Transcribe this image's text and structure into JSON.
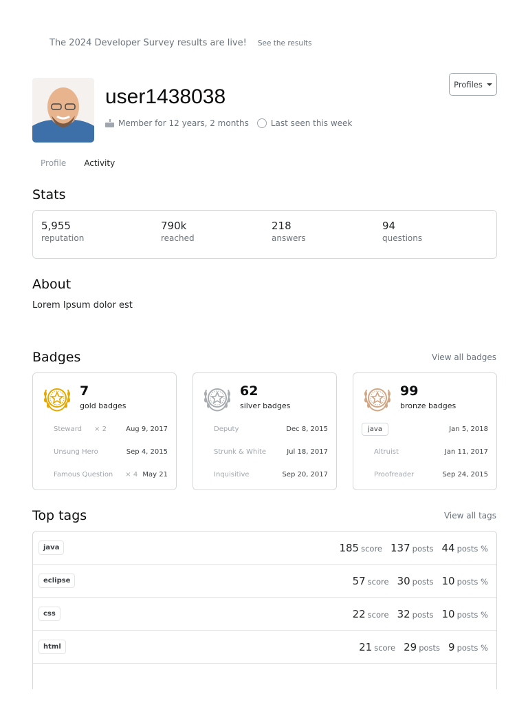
{
  "banner": {
    "text": "The 2024 Developer Survey results are live!",
    "link": "See the results"
  },
  "user": {
    "name": "user1438038",
    "member": "Member for 12 years, 2 months",
    "last_seen": "Last seen this week"
  },
  "profiles_button": "Profiles",
  "tabs": [
    {
      "label": "Profile"
    },
    {
      "label": "Activity"
    }
  ],
  "stats": {
    "title": "Stats",
    "items": [
      {
        "value": "5,955",
        "label": "reputation"
      },
      {
        "value": "790k",
        "label": "reached"
      },
      {
        "value": "218",
        "label": "answers"
      },
      {
        "value": "94",
        "label": "questions"
      }
    ]
  },
  "about": {
    "title": "About",
    "text": "Lorem Ipsum dolor est"
  },
  "badges": {
    "title": "Badges",
    "view_all": "View all badges",
    "cards": [
      {
        "count": "7",
        "kind": "gold badges",
        "color": "#e5a800",
        "rows": [
          {
            "name": "Steward",
            "mult": "× 2",
            "date": "Aug 9, 2017"
          },
          {
            "name": "Unsung Hero",
            "mult": "",
            "date": "Sep 4, 2015"
          },
          {
            "name": "Famous Question",
            "mult": "× 4",
            "date": "May 21"
          }
        ]
      },
      {
        "count": "62",
        "kind": "silver badges",
        "color": "#a8acb0",
        "rows": [
          {
            "name": "Deputy",
            "mult": "",
            "date": "Dec 8, 2015"
          },
          {
            "name": "Strunk & White",
            "mult": "",
            "date": "Jul 18, 2017"
          },
          {
            "name": "Inquisitive",
            "mult": "",
            "date": "Sep 20, 2017"
          }
        ]
      },
      {
        "count": "99",
        "kind": "bronze badges",
        "color": "#d1a684",
        "rows": [
          {
            "name": "java",
            "mult": "",
            "date": "Jan 5, 2018"
          },
          {
            "name": "Altruist",
            "mult": "",
            "date": "Jan 11, 2017"
          },
          {
            "name": "Proofreader",
            "mult": "",
            "date": "Sep 24, 2015"
          }
        ]
      }
    ]
  },
  "top_tags": {
    "title": "Top tags",
    "view_all": "View all tags",
    "score_label": "score",
    "posts_label": "posts",
    "pct_label": "posts %",
    "rows": [
      {
        "tag": "java",
        "score": "185",
        "posts": "137",
        "pct": "44"
      },
      {
        "tag": "eclipse",
        "score": "57",
        "posts": "30",
        "pct": "10"
      },
      {
        "tag": "css",
        "score": "22",
        "posts": "32",
        "pct": "10"
      },
      {
        "tag": "html",
        "score": "21",
        "posts": "29",
        "pct": "9"
      }
    ]
  }
}
